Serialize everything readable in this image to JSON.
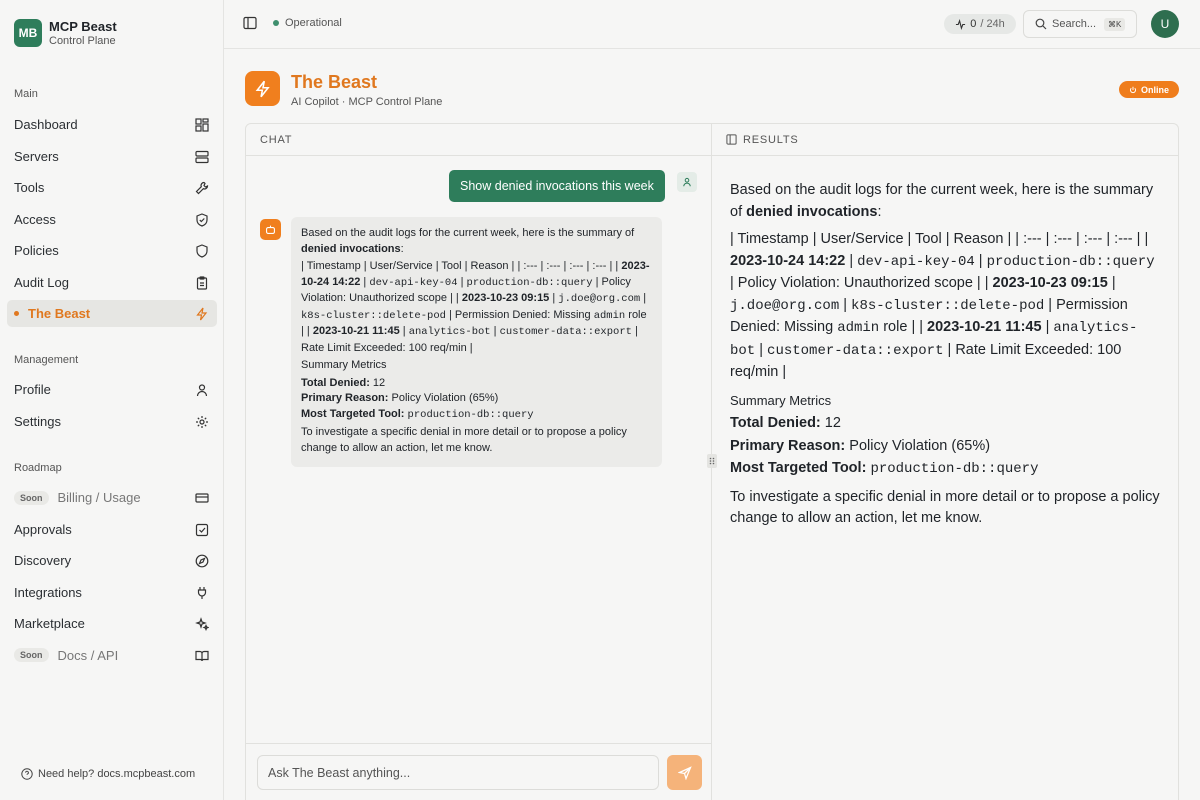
{
  "brand": {
    "logo": "MB",
    "name": "MCP Beast",
    "subtitle": "Control Plane"
  },
  "sidebar": {
    "main_label": "Main",
    "main_items": [
      {
        "label": "Dashboard",
        "icon": "grid-icon"
      },
      {
        "label": "Servers",
        "icon": "server-icon"
      },
      {
        "label": "Tools",
        "icon": "wrench-icon"
      },
      {
        "label": "Access",
        "icon": "shield-check-icon"
      },
      {
        "label": "Policies",
        "icon": "shield-icon"
      },
      {
        "label": "Audit Log",
        "icon": "clipboard-icon"
      },
      {
        "label": "The Beast",
        "icon": "bolt-icon",
        "active": true
      }
    ],
    "management_label": "Management",
    "management_items": [
      {
        "label": "Profile",
        "icon": "user-icon"
      },
      {
        "label": "Settings",
        "icon": "gear-icon"
      }
    ],
    "roadmap_label": "Roadmap",
    "roadmap_items": [
      {
        "label": "Billing / Usage",
        "soon": "Soon",
        "icon": "card-icon"
      },
      {
        "label": "Approvals",
        "icon": "checkbox-icon"
      },
      {
        "label": "Discovery",
        "icon": "compass-icon"
      },
      {
        "label": "Integrations",
        "icon": "plug-icon"
      },
      {
        "label": "Marketplace",
        "icon": "sparkle-icon"
      },
      {
        "label": "Docs / API",
        "soon": "Soon",
        "icon": "book-icon"
      }
    ],
    "help": "Need help? docs.mcpbeast.com"
  },
  "topbar": {
    "status": "Operational",
    "metric_value": "0",
    "metric_unit": "/ 24h",
    "search_label": "Search...",
    "search_shortcut": "⌘K",
    "avatar": "U"
  },
  "header": {
    "title": "The Beast",
    "subtitle": "AI Copilot · MCP Control Plane",
    "badge": "Online"
  },
  "chat": {
    "panel_title": "CHAT",
    "user_message": "Show denied invocations this week",
    "bot": {
      "intro": "Based on the audit logs for the current week, here is the summary of ",
      "intro_bold": "denied invocations",
      "table_header": "| Timestamp | User/Service | Tool | Reason | | :--- | :--- | :--- | :--- | |",
      "row1_time": "2023-10-24 14:22",
      "row1_user": "dev-api-key-04",
      "row1_tool": "production-db::query",
      "row1_reason": "Policy Violation: Unauthorized scope | |",
      "row2_time": "2023-10-23 09:15",
      "row2_user": "j.doe@org.com",
      "row2_tool": "k8s-cluster::delete-pod",
      "row2_reason_a": "Permission Denied: Missing ",
      "row2_reason_code": "admin",
      "row2_reason_b": " role | |",
      "row3_time": "2023-10-21 11:45",
      "row3_user": "analytics-bot",
      "row3_tool": "customer-data::export",
      "row3_reason": "Rate Limit Exceeded: 100 req/min |",
      "summary_title": "Summary Metrics",
      "total_label": "Total Denied:",
      "total_value": " 12",
      "reason_label": "Primary Reason:",
      "reason_value": " Policy Violation (65%)",
      "target_label": "Most Targeted Tool:",
      "target_value": "production-db::query",
      "closing": "To investigate a specific denial in more detail or to propose a policy change to allow an action, let me know."
    },
    "input_placeholder": "Ask The Beast anything..."
  },
  "results": {
    "panel_title": "RESULTS"
  }
}
